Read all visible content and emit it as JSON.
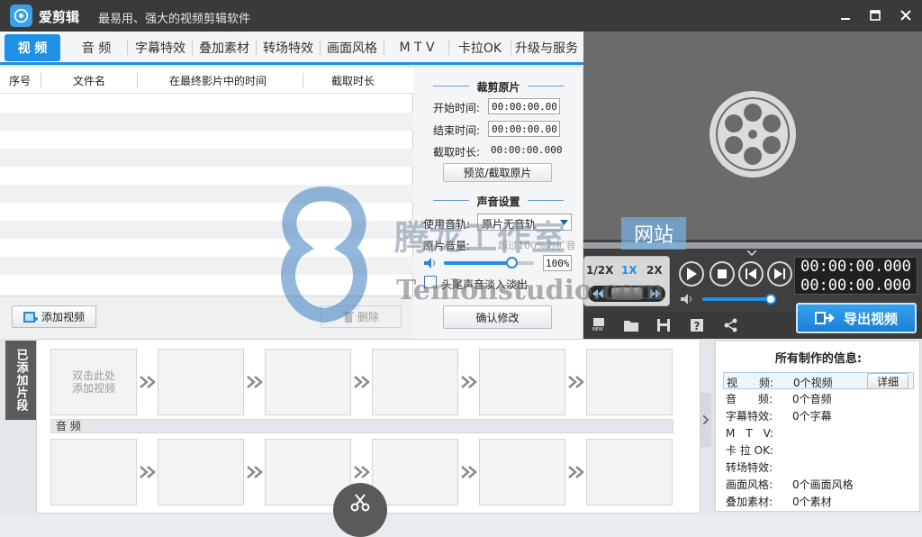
{
  "app": {
    "name": "爱剪辑",
    "slogan": "最易用、强大的视频剪辑软件"
  },
  "tabs": [
    {
      "label": "视 频",
      "active": true
    },
    {
      "label": "音 频"
    },
    {
      "label": "字幕特效"
    },
    {
      "label": "叠加素材"
    },
    {
      "label": "转场特效"
    },
    {
      "label": "画面风格"
    },
    {
      "label": "M T V"
    },
    {
      "label": "卡拉OK"
    },
    {
      "label": "升级与服务"
    }
  ],
  "table": {
    "headers": [
      "序号",
      "文件名",
      "在最终影片中的时间",
      "截取时长"
    ]
  },
  "left_footer": {
    "add_video": "添加视频",
    "delete": "删除"
  },
  "crop": {
    "title": "裁剪原片",
    "start_label": "开始时间:",
    "start_value": "00:00:00.000",
    "end_label": "结束时间:",
    "end_value": "00:00:00.000",
    "duration_label": "截取时长:",
    "duration_value": "00:00:00.000",
    "preview_button": "预览/截取原片"
  },
  "sound": {
    "title": "声音设置",
    "track_label": "使用音轨:",
    "track_value": "原片无音轨",
    "volume_label": "原片音量:",
    "volume_hint": "超过100%为扩音",
    "volume_value": "100%",
    "volume_level": 0.75,
    "fade_label": "头尾声音淡入淡出",
    "confirm_button": "确认修改"
  },
  "player": {
    "speeds": [
      "1/2X",
      "1X",
      "2X"
    ],
    "active_speed": "1X",
    "time_current": "00:00:00.000",
    "time_total": "00:00:00.000",
    "volume_level": 1.0
  },
  "toolbar": {
    "export_label": "导出视频"
  },
  "clips": {
    "sidebar_label": "已添加片段",
    "placeholder": "双击此处\n添加视频",
    "audio_label": "音 频"
  },
  "info": {
    "title": "所有制作的信息:",
    "detail_button": "详细",
    "rows": [
      {
        "key": "视　　频:",
        "value": "0个视频"
      },
      {
        "key": "音　　频:",
        "value": "0个音频"
      },
      {
        "key": "字幕特效:",
        "value": "0个字幕"
      },
      {
        "key": "M　T　V:",
        "value": ""
      },
      {
        "key": "卡 拉 OK:",
        "value": ""
      },
      {
        "key": "转场特效:",
        "value": ""
      },
      {
        "key": "画面风格:",
        "value": "0个画面风格"
      },
      {
        "key": "叠加素材:",
        "value": "0个素材"
      }
    ]
  },
  "watermark": {
    "cn": "腾龙工作室",
    "badge": "网站",
    "en": "Tenlonstudio.com"
  },
  "colors": {
    "accent": "#1e90e6",
    "titlebar": "#3a3a3a",
    "preview_bg": "#6b6b6b"
  }
}
